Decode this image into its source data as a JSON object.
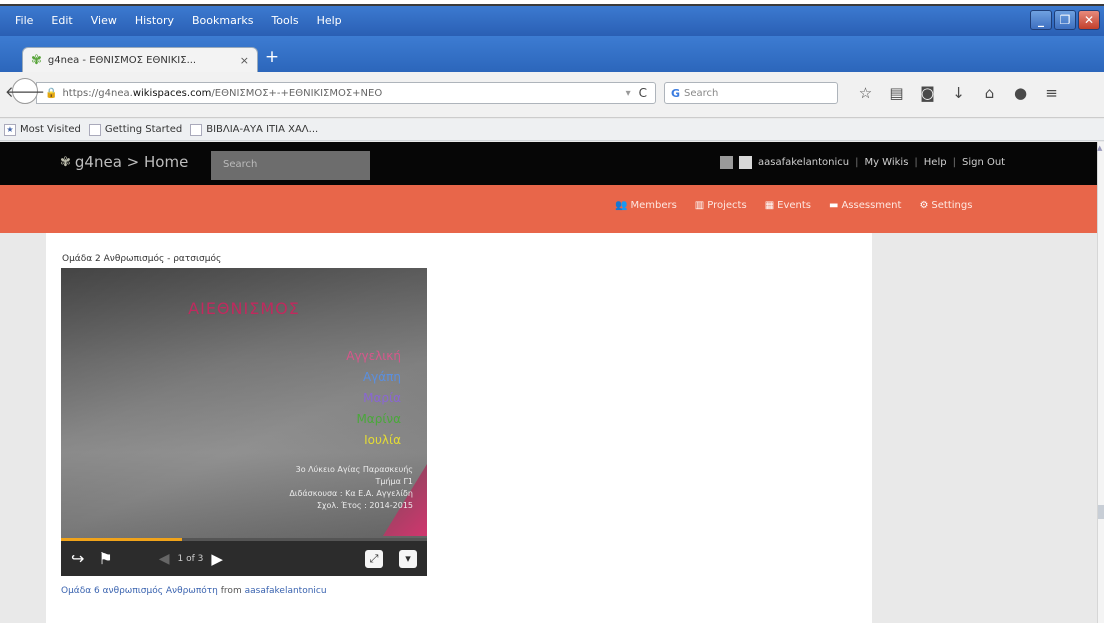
{
  "browser": {
    "menu": [
      "File",
      "Edit",
      "View",
      "History",
      "Bookmarks",
      "Tools",
      "Help"
    ],
    "tab_title": "g4nea - ΕΘΝΙΣΜΟΣ ΕΘΝΙΚΙΣ...",
    "tab_close": "×",
    "new_tab": "+",
    "url_prefix": "https://g4nea.",
    "url_domain": "wikispaces.com",
    "url_rest": "/ΕΘΝΙΣΜΟΣ+-+ΕΘΝΙΚΙΣΜΟΣ+ΝΕΟ",
    "search_placeholder": "Search",
    "bookmarks": [
      "Most Visited",
      "Getting Started",
      "ΒΙΒΛΙΑ-ΑΥΑ ΙΤΙΑ ΧΑΛ..."
    ]
  },
  "site": {
    "logo": "g4nea > Home",
    "logo_prefix": "> ",
    "search_placeholder": "Search",
    "user_name": "aasafakelantonicu",
    "header_links": [
      "My Wikis",
      "Help",
      "Sign Out"
    ],
    "nav": [
      {
        "label": "Members",
        "icon": "members-icon"
      },
      {
        "label": "Projects",
        "icon": "projects-icon"
      },
      {
        "label": "Events",
        "icon": "events-icon"
      },
      {
        "label": "Assessment",
        "icon": "assessment-icon"
      },
      {
        "label": "Settings",
        "icon": "settings-icon"
      }
    ]
  },
  "content": {
    "caption": "Ομάδα 2 Ανθρωπισμός - ρατσισμός",
    "slide": {
      "title": "ΑΙΕΘΝΙΣΜΟΣ",
      "names": [
        {
          "text": "Αγγελική",
          "color": "#d7578c"
        },
        {
          "text": "Αγάπη",
          "color": "#5a8fe0"
        },
        {
          "text": "Μαρία",
          "color": "#8a66d4"
        },
        {
          "text": "Μαρίνα",
          "color": "#4aa83a"
        },
        {
          "text": "Ιουλία",
          "color": "#e3db35"
        }
      ],
      "info": [
        "3ο Λύκειο Αγίας Παρασκευής",
        "Τμήμα Γ1",
        "Διδάσκουσα : Κα Ε.Α. Αγγελίδη",
        "Σχολ. Έτος : 2014-2015"
      ],
      "progress": 0.33,
      "pager": "1 of 3"
    },
    "link_text": "Ομάδα 6 ανθρωπισμός Ανθρωπότη",
    "link_from": "from",
    "link_author": "aasafakelantonicu"
  }
}
